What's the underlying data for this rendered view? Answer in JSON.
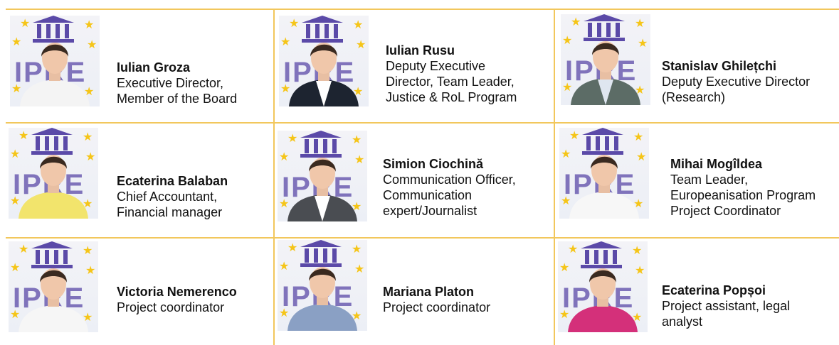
{
  "staff": [
    {
      "name": "Iulian Groza",
      "role_lines": [
        "Executive Director,",
        "Member of the Board"
      ],
      "shirt": "#f4f4f4",
      "jacket": "#f4f4f4"
    },
    {
      "name": "Iulian Rusu",
      "role_lines": [
        "Deputy Executive",
        "Director, Team Leader,",
        "Justice & RoL Program"
      ],
      "shirt": "#ffffff",
      "jacket": "#1d2430"
    },
    {
      "name": "Stanislav Ghilețchi",
      "role_lines": [
        "Deputy Executive Director",
        "(Research)"
      ],
      "shirt": "#dfe6f0",
      "jacket": "#5c6c66"
    },
    {
      "name": "Ecaterina Balaban",
      "role_lines": [
        "Chief Accountant,",
        "Financial manager"
      ],
      "shirt": "#f2e46c",
      "jacket": "#f2e46c"
    },
    {
      "name": "Simion Ciochină",
      "role_lines": [
        "Communication Officer,",
        "Communication",
        "expert/Journalist"
      ],
      "shirt": "#ffffff",
      "jacket": "#4a4d52"
    },
    {
      "name": "Mihai Mogîldea",
      "role_lines": [
        "Team Leader,",
        "Europeanisation Program",
        "Project Coordinator"
      ],
      "shirt": "#f7f7f7",
      "jacket": "#f7f7f7"
    },
    {
      "name": "Victoria Nemerenco",
      "role_lines": [
        "Project coordinator"
      ],
      "shirt": "#f6f6f6",
      "jacket": "#f6f6f6"
    },
    {
      "name": "Mariana Platon",
      "role_lines": [
        "Project coordinator"
      ],
      "shirt": "#8aa0c4",
      "jacket": "#8aa0c4"
    },
    {
      "name": "Ecaterina Popșoi",
      "role_lines": [
        "Project assistant, legal",
        "analyst"
      ],
      "shirt": "#d4307a",
      "jacket": "#d4307a"
    }
  ],
  "logo": {
    "text": "IPRE",
    "color": "#5b4aa8",
    "star_color": "#f5c518"
  },
  "divider_color": "#f2c75c"
}
